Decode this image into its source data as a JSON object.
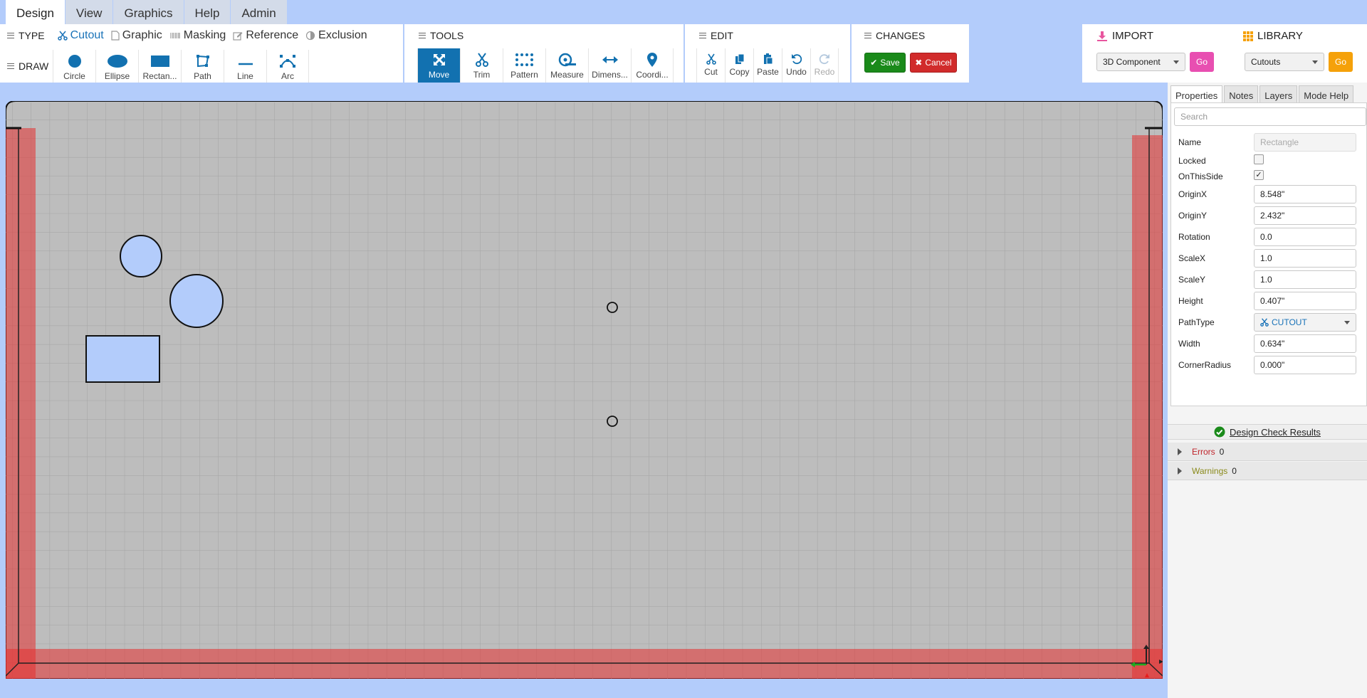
{
  "nav_tabs": [
    {
      "label": "Design",
      "active": true
    },
    {
      "label": "View",
      "active": false
    },
    {
      "label": "Graphics",
      "active": false
    },
    {
      "label": "Help",
      "active": false
    },
    {
      "label": "Admin",
      "active": false
    }
  ],
  "type_panel": {
    "label": "TYPE",
    "items": [
      "Cutout",
      "Graphic",
      "Masking",
      "Reference",
      "Exclusion"
    ],
    "selected": "Cutout"
  },
  "draw_panel": {
    "label": "DRAW",
    "tools": [
      "Circle",
      "Ellipse",
      "Rectan...",
      "Path",
      "Line",
      "Arc"
    ]
  },
  "tools_panel": {
    "title": "TOOLS",
    "tools": [
      "Move",
      "Trim",
      "Pattern",
      "Measure",
      "Dimens...",
      "Coordi..."
    ],
    "active": "Move"
  },
  "edit_panel": {
    "title": "EDIT",
    "tools": [
      "Cut",
      "Copy",
      "Paste",
      "Undo",
      "Redo"
    ],
    "disabled": [
      "Redo"
    ]
  },
  "changes_panel": {
    "title": "CHANGES",
    "save_label": "Save",
    "cancel_label": "Cancel"
  },
  "import_panel": {
    "title": "IMPORT",
    "selected": "3D Component",
    "go_label": "Go",
    "go_color": "#e84fb1"
  },
  "library_panel": {
    "title": "LIBRARY",
    "selected": "Cutouts",
    "go_label": "Go",
    "go_color": "#f5a10a"
  },
  "props": {
    "tabs": [
      "Properties",
      "Notes",
      "Layers",
      "Mode Help"
    ],
    "active_tab": "Properties",
    "search_placeholder": "Search",
    "name_label": "Name",
    "name_value": "Rectangle",
    "locked_label": "Locked",
    "locked": false,
    "onthisside_label": "OnThisSide",
    "onthisside": true,
    "originx_label": "OriginX",
    "originx": "8.548\"",
    "originy_label": "OriginY",
    "originy": "2.432\"",
    "rotation_label": "Rotation",
    "rotation": "0.0",
    "scalex_label": "ScaleX",
    "scalex": "1.0",
    "scaley_label": "ScaleY",
    "scaley": "1.0",
    "height_label": "Height",
    "height": "0.407\"",
    "pathtype_label": "PathType",
    "pathtype": "CUTOUT",
    "width_label": "Width",
    "width": "0.634\"",
    "cornerradius_label": "CornerRadius",
    "cornerradius": "0.000\""
  },
  "design_check": {
    "title": "Design Check Results",
    "errors_label": "Errors",
    "errors": "0",
    "warnings_label": "Warnings",
    "warnings": "0"
  },
  "colors": {
    "accent": "#1271b0",
    "shape_fill": "#b3ccfb",
    "board": "#bdbdbd",
    "exclusion_red": "#e63030"
  }
}
